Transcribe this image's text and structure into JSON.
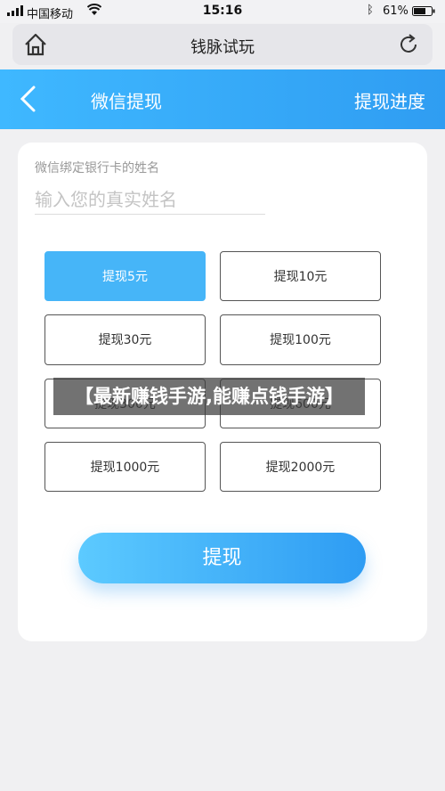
{
  "status_bar": {
    "carrier": "中国移动",
    "time": "15:16",
    "battery": "61%"
  },
  "browser": {
    "title": "钱脉试玩"
  },
  "header": {
    "title": "微信提现",
    "progress_link": "提现进度"
  },
  "form": {
    "name_label": "微信绑定银行卡的姓名",
    "name_placeholder": "输入您的真实姓名",
    "name_value": ""
  },
  "amounts": [
    {
      "label": "提现5元",
      "selected": true
    },
    {
      "label": "提现10元",
      "selected": false
    },
    {
      "label": "提现30元",
      "selected": false
    },
    {
      "label": "提现100元",
      "selected": false
    },
    {
      "label": "提现300元",
      "selected": false
    },
    {
      "label": "提现600元",
      "selected": false
    },
    {
      "label": "提现1000元",
      "selected": false
    },
    {
      "label": "提现2000元",
      "selected": false
    }
  ],
  "submit_label": "提现",
  "overlay_banner": "【最新赚钱手游,能赚点钱手游】",
  "colors": {
    "accent": "#2f9df2",
    "selected_amount": "#46b5f8"
  }
}
